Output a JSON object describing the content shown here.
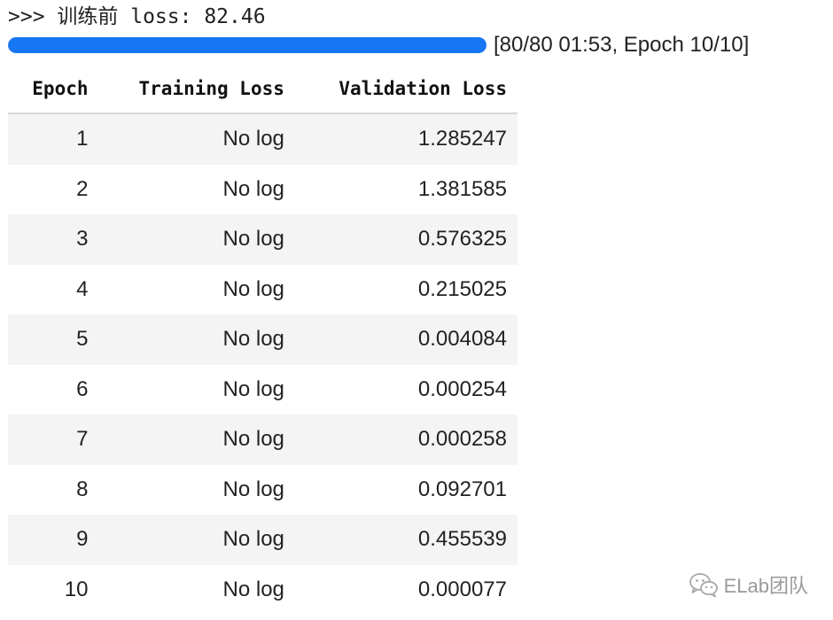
{
  "console": {
    "prompt_line": ">>> 训练前 loss: 82.46"
  },
  "progress": {
    "fraction": 1.0,
    "text": "[80/80 01:53, Epoch 10/10]",
    "fill_color": "#1676f3"
  },
  "table": {
    "headers": [
      "Epoch",
      "Training Loss",
      "Validation Loss"
    ],
    "rows": [
      [
        "1",
        "No log",
        "1.285247"
      ],
      [
        "2",
        "No log",
        "1.381585"
      ],
      [
        "3",
        "No log",
        "0.576325"
      ],
      [
        "4",
        "No log",
        "0.215025"
      ],
      [
        "5",
        "No log",
        "0.004084"
      ],
      [
        "6",
        "No log",
        "0.000254"
      ],
      [
        "7",
        "No log",
        "0.000258"
      ],
      [
        "8",
        "No log",
        "0.092701"
      ],
      [
        "9",
        "No log",
        "0.455539"
      ],
      [
        "10",
        "No log",
        "0.000077"
      ]
    ]
  },
  "watermark": {
    "icon": "wechat-icon",
    "text": "ELab团队"
  }
}
